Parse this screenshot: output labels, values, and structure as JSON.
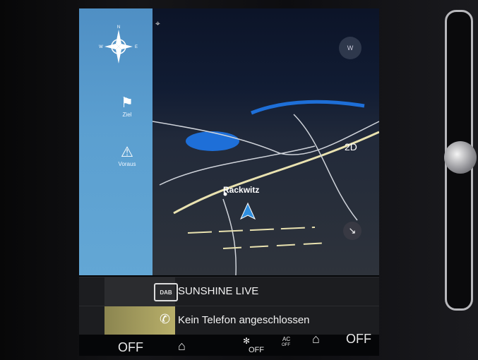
{
  "sidebar": {
    "compass_letters": [
      "N",
      "E",
      "W"
    ],
    "items": [
      {
        "label": "Ziel",
        "icon": "checkered-flag-icon"
      },
      {
        "label": "Voraus",
        "icon": "pin-warning-icon"
      }
    ]
  },
  "map": {
    "city_label": "Rackwitz",
    "view_mode": "2D",
    "compass_button": "W",
    "expand_button": "↘"
  },
  "tiles": {
    "radio": {
      "station": "SUNSHINE LIVE",
      "icon_label": "DAB"
    },
    "phone": {
      "status": "Kein Telefon angeschlossen"
    }
  },
  "climate": {
    "left_temp": "OFF",
    "fan": "OFF",
    "ac_label": "AC",
    "ac_state": "OFF",
    "right_temp": "OFF"
  },
  "colors": {
    "sidebar": "#5b9fd0",
    "map_water": "#1e6fd8",
    "route": "#e9e2b0",
    "phone_tile": "#b8af6a"
  }
}
